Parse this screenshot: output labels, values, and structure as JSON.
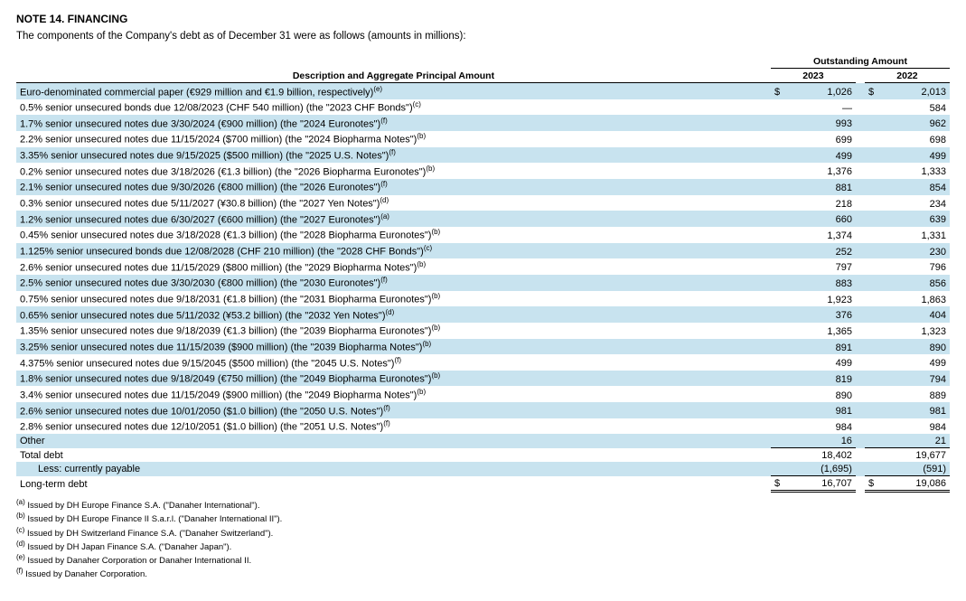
{
  "title": "NOTE 14. FINANCING",
  "intro": "The components of the Company's debt as of December 31 were as follows (amounts in millions):",
  "headers": {
    "desc": "Description and Aggregate Principal Amount",
    "outstanding": "Outstanding Amount",
    "y1": "2023",
    "y2": "2022"
  },
  "currency": "$",
  "rows": [
    {
      "desc": "Euro-denominated commercial paper (€929 million and €1.9 billion, respectively)",
      "sup": "(e)",
      "v1": "1,026",
      "v2": "2,013",
      "stripe": true,
      "showcur": true
    },
    {
      "desc": "0.5% senior unsecured bonds due 12/08/2023 (CHF 540 million) (the \"2023 CHF Bonds\")",
      "sup": "(c)",
      "v1": "—",
      "v2": "584",
      "stripe": false
    },
    {
      "desc": "1.7% senior unsecured notes due 3/30/2024 (€900 million) (the \"2024 Euronotes\")",
      "sup": "(f)",
      "v1": "993",
      "v2": "962",
      "stripe": true
    },
    {
      "desc": "2.2% senior unsecured notes due 11/15/2024 ($700 million) (the \"2024 Biopharma Notes\")",
      "sup": "(b)",
      "v1": "699",
      "v2": "698",
      "stripe": false
    },
    {
      "desc": "3.35% senior unsecured notes due 9/15/2025 ($500 million) (the \"2025 U.S. Notes\")",
      "sup": "(f)",
      "v1": "499",
      "v2": "499",
      "stripe": true
    },
    {
      "desc": "0.2% senior unsecured notes due 3/18/2026 (€1.3 billion) (the \"2026 Biopharma Euronotes\")",
      "sup": "(b)",
      "v1": "1,376",
      "v2": "1,333",
      "stripe": false
    },
    {
      "desc": "2.1% senior unsecured notes due 9/30/2026 (€800 million) (the \"2026 Euronotes\")",
      "sup": "(f)",
      "v1": "881",
      "v2": "854",
      "stripe": true
    },
    {
      "desc": "0.3% senior unsecured notes due 5/11/2027 (¥30.8 billion) (the \"2027 Yen Notes\")",
      "sup": "(d)",
      "v1": "218",
      "v2": "234",
      "stripe": false
    },
    {
      "desc": "1.2% senior unsecured notes due 6/30/2027 (€600 million) (the \"2027 Euronotes\")",
      "sup": "(a)",
      "v1": "660",
      "v2": "639",
      "stripe": true
    },
    {
      "desc": "0.45% senior unsecured notes due 3/18/2028 (€1.3 billion) (the \"2028 Biopharma Euronotes\")",
      "sup": "(b)",
      "v1": "1,374",
      "v2": "1,331",
      "stripe": false
    },
    {
      "desc": "1.125% senior unsecured bonds due 12/08/2028 (CHF 210 million) (the \"2028 CHF Bonds\")",
      "sup": "(c)",
      "v1": "252",
      "v2": "230",
      "stripe": true
    },
    {
      "desc": "2.6% senior unsecured notes due 11/15/2029 ($800 million) (the \"2029 Biopharma Notes\")",
      "sup": "(b)",
      "v1": "797",
      "v2": "796",
      "stripe": false
    },
    {
      "desc": "2.5% senior unsecured notes due 3/30/2030 (€800 million) (the \"2030 Euronotes\")",
      "sup": "(f)",
      "v1": "883",
      "v2": "856",
      "stripe": true
    },
    {
      "desc": "0.75% senior unsecured notes due 9/18/2031 (€1.8 billion) (the \"2031 Biopharma Euronotes\")",
      "sup": "(b)",
      "v1": "1,923",
      "v2": "1,863",
      "stripe": false
    },
    {
      "desc": "0.65% senior unsecured notes due 5/11/2032 (¥53.2 billion) (the \"2032 Yen Notes\")",
      "sup": "(d)",
      "v1": "376",
      "v2": "404",
      "stripe": true
    },
    {
      "desc": "1.35% senior unsecured notes due 9/18/2039 (€1.3 billion) (the \"2039 Biopharma Euronotes\")",
      "sup": "(b)",
      "v1": "1,365",
      "v2": "1,323",
      "stripe": false
    },
    {
      "desc": "3.25% senior unsecured notes due 11/15/2039 ($900 million) (the \"2039 Biopharma Notes\")",
      "sup": "(b)",
      "v1": "891",
      "v2": "890",
      "stripe": true
    },
    {
      "desc": "4.375% senior unsecured notes due 9/15/2045 ($500 million) (the \"2045 U.S. Notes\")",
      "sup": "(f)",
      "v1": "499",
      "v2": "499",
      "stripe": false
    },
    {
      "desc": "1.8% senior unsecured notes due 9/18/2049 (€750 million) (the \"2049 Biopharma Euronotes\")",
      "sup": "(b)",
      "v1": "819",
      "v2": "794",
      "stripe": true
    },
    {
      "desc": "3.4% senior unsecured notes due 11/15/2049 ($900 million) (the \"2049 Biopharma Notes\")",
      "sup": "(b)",
      "v1": "890",
      "v2": "889",
      "stripe": false
    },
    {
      "desc": "2.6% senior unsecured notes due 10/01/2050 ($1.0 billion) (the \"2050 U.S. Notes\")",
      "sup": "(f)",
      "v1": "981",
      "v2": "981",
      "stripe": true
    },
    {
      "desc": "2.8% senior unsecured notes due 12/10/2051 ($1.0 billion) (the \"2051 U.S. Notes\")",
      "sup": "(f)",
      "v1": "984",
      "v2": "984",
      "stripe": false
    },
    {
      "desc": "Other",
      "sup": "",
      "v1": "16",
      "v2": "21",
      "stripe": true
    }
  ],
  "totals": {
    "total_debt_label": "Total debt",
    "total_debt_v1": "18,402",
    "total_debt_v2": "19,677",
    "less_label": "Less: currently payable",
    "less_v1": "(1,695)",
    "less_v2": "(591)",
    "long_term_label": "Long-term debt",
    "long_term_v1": "16,707",
    "long_term_v2": "19,086"
  },
  "footnotes": [
    {
      "sup": "(a)",
      "text": " Issued by DH Europe Finance S.A. (\"Danaher International\")."
    },
    {
      "sup": "(b)",
      "text": " Issued by DH Europe Finance II S.a.r.l. (\"Danaher International II\")."
    },
    {
      "sup": "(c)",
      "text": " Issued by DH Switzerland Finance S.A. (\"Danaher Switzerland\")."
    },
    {
      "sup": "(d)",
      "text": " Issued by DH Japan Finance S.A. (\"Danaher Japan\")."
    },
    {
      "sup": "(e)",
      "text": " Issued by Danaher Corporation or Danaher International II."
    },
    {
      "sup": "(f)",
      "text": " Issued by Danaher Corporation."
    }
  ]
}
